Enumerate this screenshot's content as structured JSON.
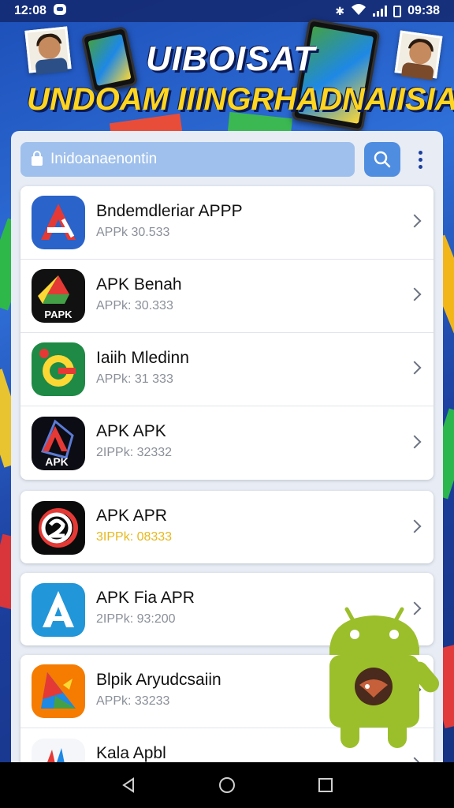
{
  "status_bar": {
    "time_left": "12:08",
    "time_right": "09:38"
  },
  "banner": {
    "title_line1": "UIBOISAT",
    "title_line2": "UNDOAM IIINGRHADNAIISIA"
  },
  "search": {
    "placeholder": "Inidoanaenontin"
  },
  "apps": [
    {
      "name": "Bndemdleriar APPP",
      "sub": "APPk 30.533",
      "icon": "red-a-icon"
    },
    {
      "name": "APK Benah",
      "sub": "APPk: 30.333",
      "icon": "drive-triangle-icon",
      "icon_label": "PAPK"
    },
    {
      "name": "Iaiih Mledinn",
      "sub": "APPk: 31 333",
      "icon": "green-g-icon"
    },
    {
      "name": "APK APK",
      "sub": "2IPPk: 32332",
      "icon": "dark-a-apk-icon",
      "icon_label": "APK"
    },
    {
      "name": "APK APR",
      "sub": "3IPPk: 08333",
      "icon": "black-2-icon"
    },
    {
      "name": "APK Fia APR",
      "sub": "2IPPk: 93:200",
      "icon": "blue-a-icon"
    },
    {
      "name": "Blpik Aryudcsaiin",
      "sub": "APPk: 33233",
      "icon": "colorful-play-icon"
    },
    {
      "name": "Kala Apbl",
      "sub": "",
      "icon": "sparkle-icon"
    }
  ],
  "colors": {
    "background": "#1d4fb8",
    "search_bar": "#9fc0ec",
    "search_button": "#4f8de0",
    "android_green": "#9bbf2b",
    "highlight_yellow": "#e7b81d"
  }
}
